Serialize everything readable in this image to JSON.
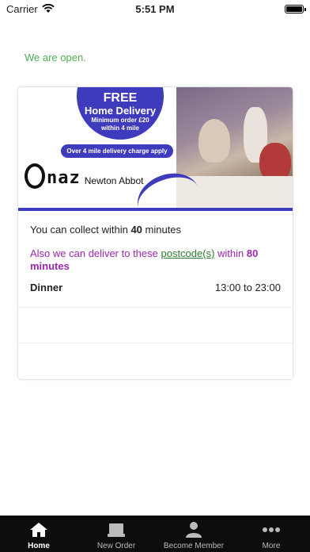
{
  "status_bar": {
    "carrier": "Carrier",
    "time": "5:51 PM"
  },
  "open_status": "We are open.",
  "banner": {
    "free": "FREE",
    "home_delivery": "Home Delivery",
    "minimum_line1": "Minimum order £20",
    "minimum_line2": "within 4 mile",
    "over_charge": "Over 4 mile delivery charge apply",
    "brand": "naz",
    "town": "Newton Abbot",
    "accent": "#3f3bbd"
  },
  "info": {
    "collect_prefix": "You can collect within ",
    "collect_minutes": "40",
    "collect_suffix": " minutes",
    "deliver_prefix": "Also we can deliver to these ",
    "deliver_link": "postcode(s)",
    "deliver_mid": " within ",
    "deliver_minutes": "80 minutes"
  },
  "hours": {
    "label": "Dinner",
    "time": "13:00 to 23:00"
  },
  "tabs": [
    {
      "label": "Home",
      "icon": "home-icon",
      "active": true
    },
    {
      "label": "New Order",
      "icon": "order-icon",
      "active": false
    },
    {
      "label": "Become Member",
      "icon": "member-icon",
      "active": false
    },
    {
      "label": "More",
      "icon": "more-icon",
      "active": false
    }
  ],
  "colors": {
    "open": "#4caf50",
    "deliver": "#9c27b0",
    "link": "#2e7d32"
  }
}
